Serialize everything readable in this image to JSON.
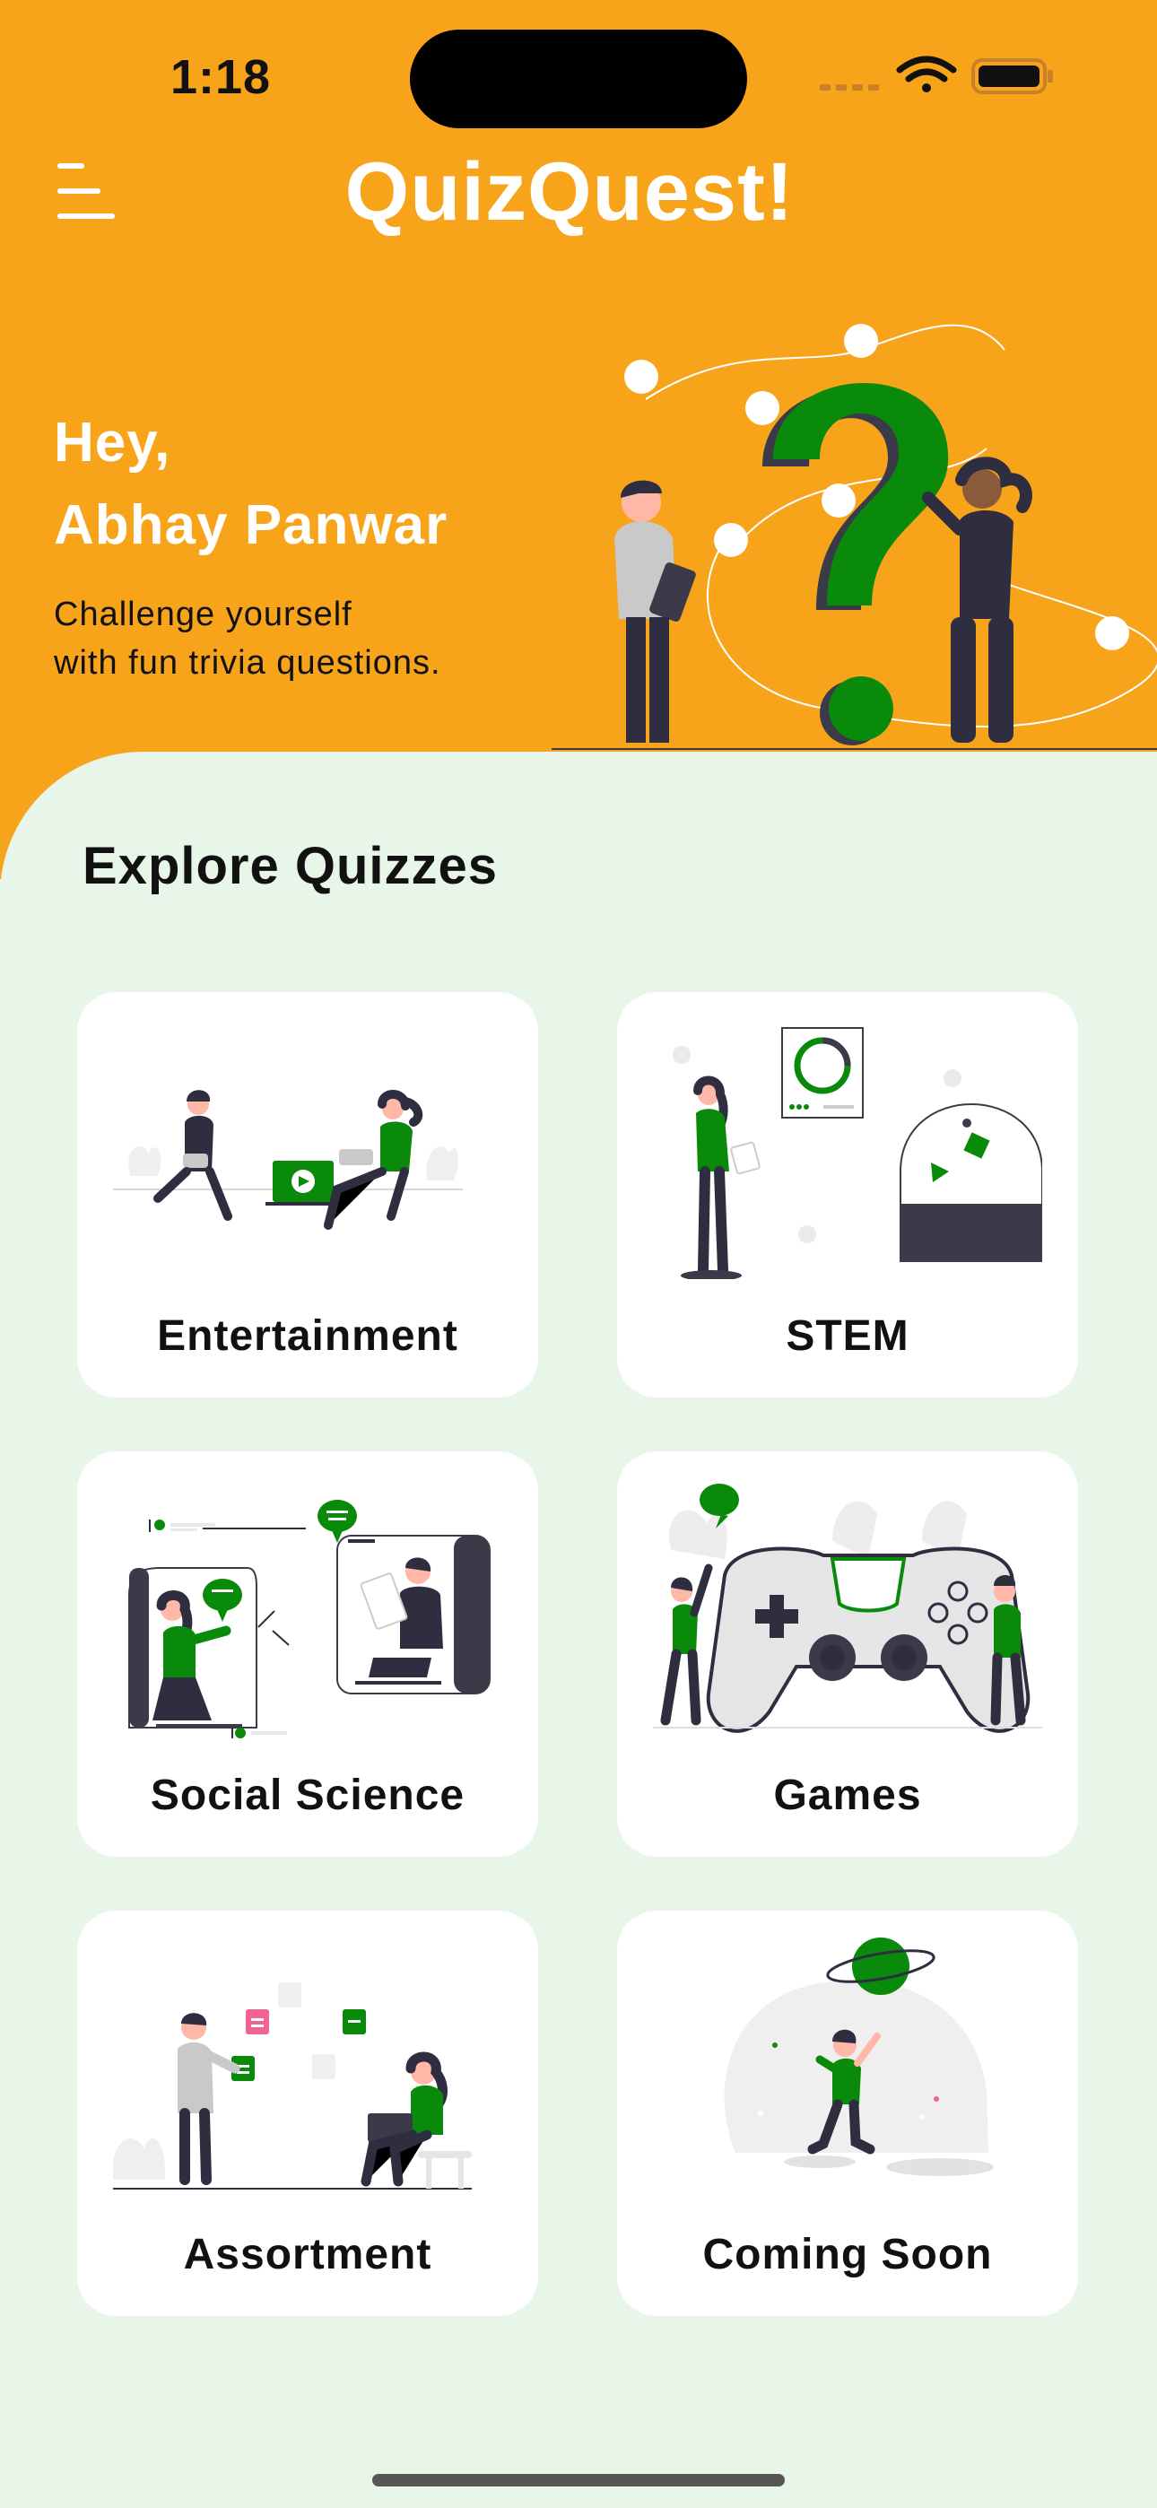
{
  "status_bar": {
    "time": "1:18"
  },
  "header": {
    "title": "QuizQuest!",
    "menu_icon": "menu-icon"
  },
  "greeting": {
    "line1": "Hey,",
    "line2": "Abhay Panwar",
    "tagline_line1": "Challenge yourself",
    "tagline_line2": "with fun trivia questions."
  },
  "section": {
    "title": "Explore Quizzes"
  },
  "categories": [
    {
      "label": "Entertainment"
    },
    {
      "label": "STEM"
    },
    {
      "label": "Social Science"
    },
    {
      "label": "Games"
    },
    {
      "label": "Assortment"
    },
    {
      "label": "Coming Soon"
    }
  ],
  "colors": {
    "header": "#F7A41B",
    "background": "#E8F5E9",
    "accent_green": "#0A8A0A",
    "dark": "#3B3A48"
  }
}
